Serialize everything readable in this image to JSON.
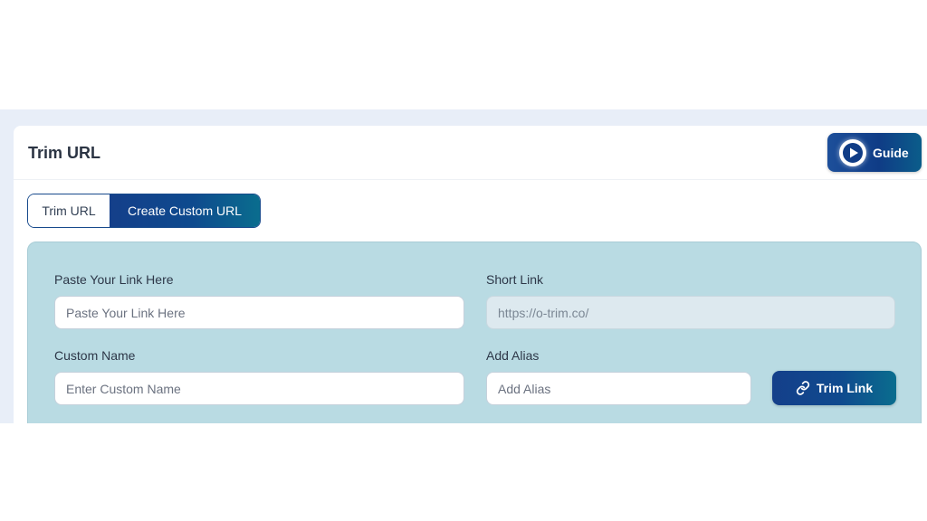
{
  "card": {
    "title": "Trim URL",
    "guide_button": {
      "label": "Guide",
      "icon": "play-circle-icon"
    }
  },
  "tabs": [
    {
      "label": "Trim URL",
      "active": false
    },
    {
      "label": "Create Custom URL",
      "active": true
    }
  ],
  "form": {
    "paste_link": {
      "label": "Paste Your Link Here",
      "placeholder": "Paste Your Link Here"
    },
    "short_link": {
      "label": "Short Link",
      "placeholder": "https://o-trim.co/"
    },
    "custom_name": {
      "label": "Custom Name",
      "placeholder": "Enter Custom Name"
    },
    "alias": {
      "label": "Add Alias",
      "placeholder": "Add Alias"
    },
    "trim_button": {
      "label": "Trim Link",
      "icon": "link-icon"
    }
  },
  "colors": {
    "brand_dark": "#143f8a",
    "brand_teal": "#0a6d8e",
    "panel_bg": "#b9dbe3",
    "page_bg": "#e8eef8"
  }
}
